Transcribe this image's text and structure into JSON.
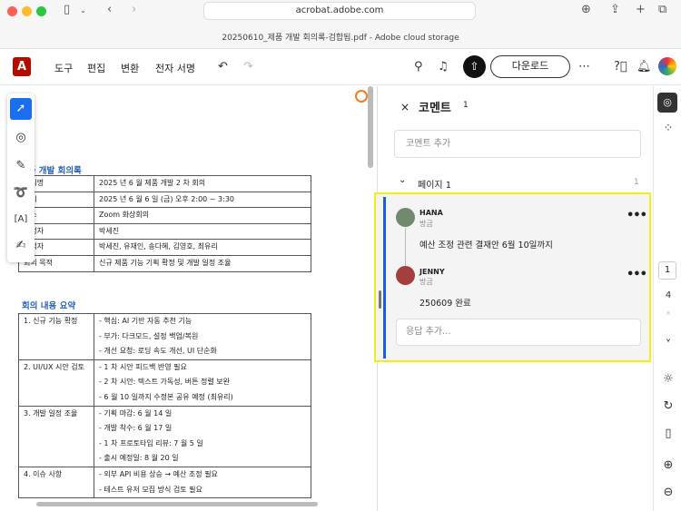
{
  "browser": {
    "url": "acrobat.adobe.com",
    "tab_title": "20250610_제품 개발 회의록-검합됨.pdf - Adobe cloud storage"
  },
  "toolbar": {
    "menu": [
      "도구",
      "편집",
      "변환",
      "전자 서명"
    ],
    "download_label": "다운로드"
  },
  "document": {
    "title": "제품 개발 회의록",
    "info_table": [
      [
        "회의명",
        "2025 년 6 월 제품 개발 2 차 회의"
      ],
      [
        "일시",
        "2025 년 6 월 6 일 (금) 오후 2:00 ~ 3:30"
      ],
      [
        "장소",
        "Zoom 화상회의"
      ],
      [
        "작성자",
        "박세진"
      ],
      [
        "참석자",
        "박세진, 유재인, 송다혜, 김영호, 최유리"
      ],
      [
        "회의 목적",
        "신규 제품 기능 기획 확정 및 개발 일정 조율"
      ]
    ],
    "summary_title": "회의 내용 요약",
    "summary_table": [
      {
        "topic": "1. 신규 기능 확정",
        "items": [
          "- 핵심: AI 기반 자동 추천 기능",
          "- 부가: 다크모드, 설정 백업/복원",
          "- 개선 요청: 로딩 속도 개선, UI 단순화"
        ]
      },
      {
        "topic": "2. UI/UX 시안 검토",
        "items": [
          "- 1 차 시안 피드백 반영 필요",
          "- 2 차 시안: 텍스트 가독성, 버튼 정렬 보완",
          "- 6 월 10 일까지 수정본 공유 예정 (최유리)"
        ]
      },
      {
        "topic": "3. 개발 일정 조율",
        "items": [
          "- 기획 마감: 6 월 14 일",
          "- 개발 착수: 6 월 17 일",
          "- 1 차 프로토타입 리뷰: 7 월 5 일",
          "- 출시 예정일: 8 월 20 일"
        ]
      },
      {
        "topic": "4. 이슈 사항",
        "items": [
          "- 외부 API 비용 상승 → 예산 조정 필요",
          "- 테스트 유저 모집 방식 검토 필요"
        ]
      }
    ]
  },
  "comments": {
    "title": "코멘트",
    "count": "1",
    "add_placeholder": "코멘트 추가",
    "page_label": "페이지 1",
    "page_count": "1",
    "thread": [
      {
        "author": "HANA",
        "time": "방금",
        "text": "예산 조정 관련 결재안 6월 10일까지",
        "color": "#6f8a6c"
      },
      {
        "author": "JENNY",
        "time": "방금",
        "text": "250609 완료",
        "color": "#a43f3f"
      }
    ],
    "reply_placeholder": "응답 추가..."
  },
  "rail": {
    "current_page": "1",
    "total_pages": "4"
  }
}
